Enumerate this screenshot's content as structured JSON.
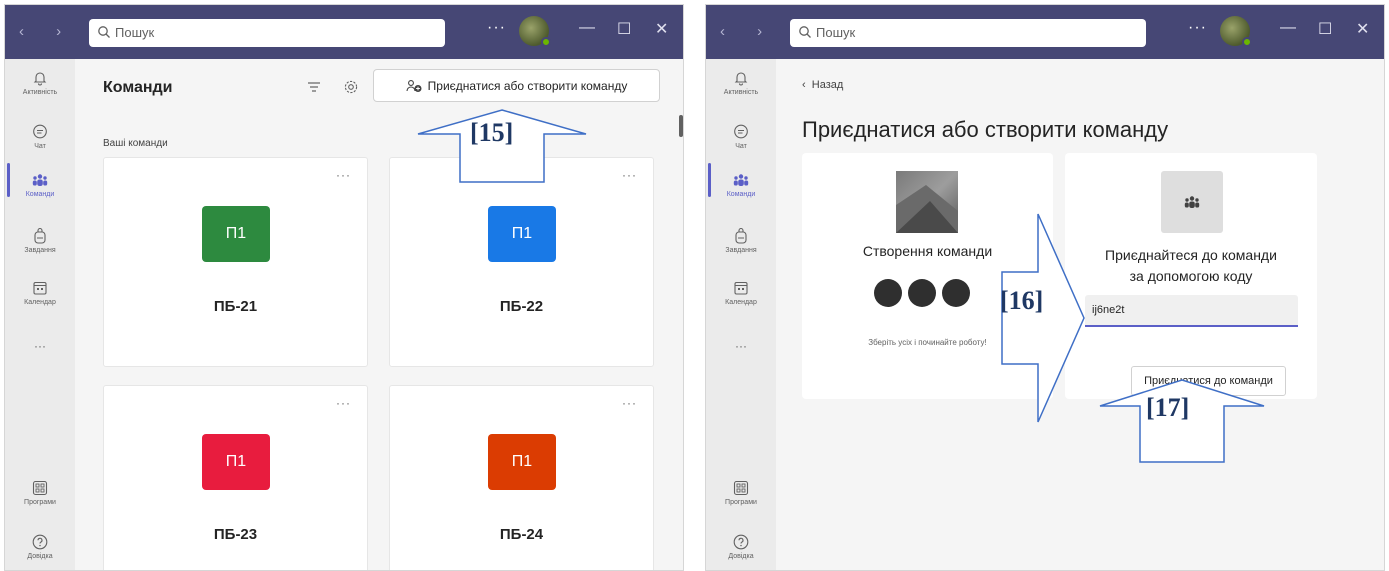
{
  "left_window": {
    "search_placeholder": "Пошук",
    "title": "Команди",
    "join_create_label": "Приєднатися або створити команду",
    "section_label": "Ваші команди",
    "teams": [
      {
        "name": "ПБ-21",
        "initials": "П1",
        "color": "#2d8a3f"
      },
      {
        "name": "ПБ-22",
        "initials": "П1",
        "color": "#1979e6"
      },
      {
        "name": "ПБ-23",
        "initials": "П1",
        "color": "#e81c3e"
      },
      {
        "name": "ПБ-24",
        "initials": "П1",
        "color": "#db3c02"
      }
    ]
  },
  "right_window": {
    "search_placeholder": "Пошук",
    "back_label": "Назад",
    "page_title": "Приєднатися або створити команду",
    "create_title": "Створення команди",
    "create_description": "Зберіть усіх і починайте роботу!",
    "join_title_line1": "Приєднайтеся до команди",
    "join_title_line2": "за допомогою коду",
    "code_value": "ij6ne2t",
    "join_button": "Приєднатися до команди"
  },
  "rail": {
    "activity": "Активність",
    "chat": "Чат",
    "teams": "Команди",
    "assignments": "Завдання",
    "calendar": "Календар",
    "more": "···",
    "apps": "Програми",
    "help": "Довідка"
  },
  "window_controls": {
    "more": "···",
    "minimize": "—",
    "maximize": "☐",
    "close": "✕"
  },
  "nav_arrows": "‹ ›",
  "card_more": "···",
  "callouts": {
    "c15": "[15]",
    "c16": "[16]",
    "c17": "[17]"
  },
  "colors": {
    "titlebar": "#464775",
    "accent": "#5b5fc7",
    "callout_text": "#1f3864",
    "callout_stroke": "#3f6fc6"
  }
}
